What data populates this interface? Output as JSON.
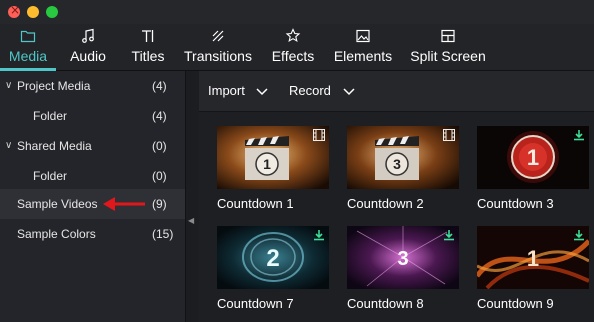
{
  "tabs": [
    {
      "label": "Media",
      "icon": "folder-icon",
      "active": true
    },
    {
      "label": "Audio",
      "icon": "music-note-icon",
      "active": false
    },
    {
      "label": "Titles",
      "icon": "text-icon",
      "active": false
    },
    {
      "label": "Transitions",
      "icon": "transition-icon",
      "active": false
    },
    {
      "label": "Effects",
      "icon": "effects-icon",
      "active": false
    },
    {
      "label": "Elements",
      "icon": "image-icon",
      "active": false
    },
    {
      "label": "Split Screen",
      "icon": "split-screen-icon",
      "active": false
    }
  ],
  "sidebar": {
    "items": [
      {
        "label": "Project Media",
        "count": "(4)",
        "expanded": true
      },
      {
        "label": "Folder",
        "count": "(4)"
      },
      {
        "label": "Shared Media",
        "count": "(0)",
        "expanded": true
      },
      {
        "label": "Folder",
        "count": "(0)"
      },
      {
        "label": "Sample Videos",
        "count": "(9)",
        "selected": true
      },
      {
        "label": "Sample Colors",
        "count": "(15)"
      }
    ]
  },
  "toolbar": {
    "import_label": "Import",
    "record_label": "Record"
  },
  "media": [
    {
      "title": "Countdown 1",
      "digit": "1",
      "badge": "film-icon"
    },
    {
      "title": "Countdown 2",
      "digit": "3",
      "badge": "film-icon"
    },
    {
      "title": "Countdown 3",
      "digit": "1",
      "badge": "download-icon"
    },
    {
      "title": "Countdown 7",
      "digit": "2",
      "badge": "download-icon"
    },
    {
      "title": "Countdown 8",
      "digit": "3",
      "badge": "download-icon"
    },
    {
      "title": "Countdown 9",
      "digit": "1",
      "badge": "download-icon"
    }
  ],
  "colors": {
    "accent": "#4fc6c7",
    "annotation_arrow": "#e0181b",
    "download_badge": "#3ddc97"
  }
}
